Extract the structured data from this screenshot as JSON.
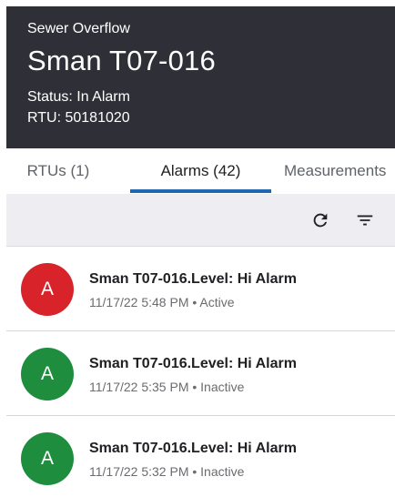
{
  "header": {
    "category": "Sewer Overflow",
    "title": "Sman T07-016",
    "status": "Status: In Alarm",
    "rtu": "RTU: 50181020"
  },
  "tabs": [
    {
      "label": "RTUs (1)",
      "active": false
    },
    {
      "label": "Alarms (42)",
      "active": true
    },
    {
      "label": "Measurements",
      "active": false
    }
  ],
  "toolbar": {
    "refresh_icon": "refresh-icon",
    "filter_icon": "filter-icon"
  },
  "alarms": [
    {
      "avatar_letter": "A",
      "avatar_color": "#d8232a",
      "title": "Sman T07-016.Level: Hi Alarm",
      "subtitle": "11/17/22 5:48 PM • Active"
    },
    {
      "avatar_letter": "A",
      "avatar_color": "#1e8e3e",
      "title": "Sman T07-016.Level: Hi Alarm",
      "subtitle": "11/17/22 5:35 PM • Inactive"
    },
    {
      "avatar_letter": "A",
      "avatar_color": "#1e8e3e",
      "title": "Sman T07-016.Level: Hi Alarm",
      "subtitle": "11/17/22 5:32 PM • Inactive"
    }
  ],
  "colors": {
    "header_bg": "#2f2f38",
    "tab_indicator": "#1f66b3",
    "toolbar_bg": "#eeeef2"
  }
}
